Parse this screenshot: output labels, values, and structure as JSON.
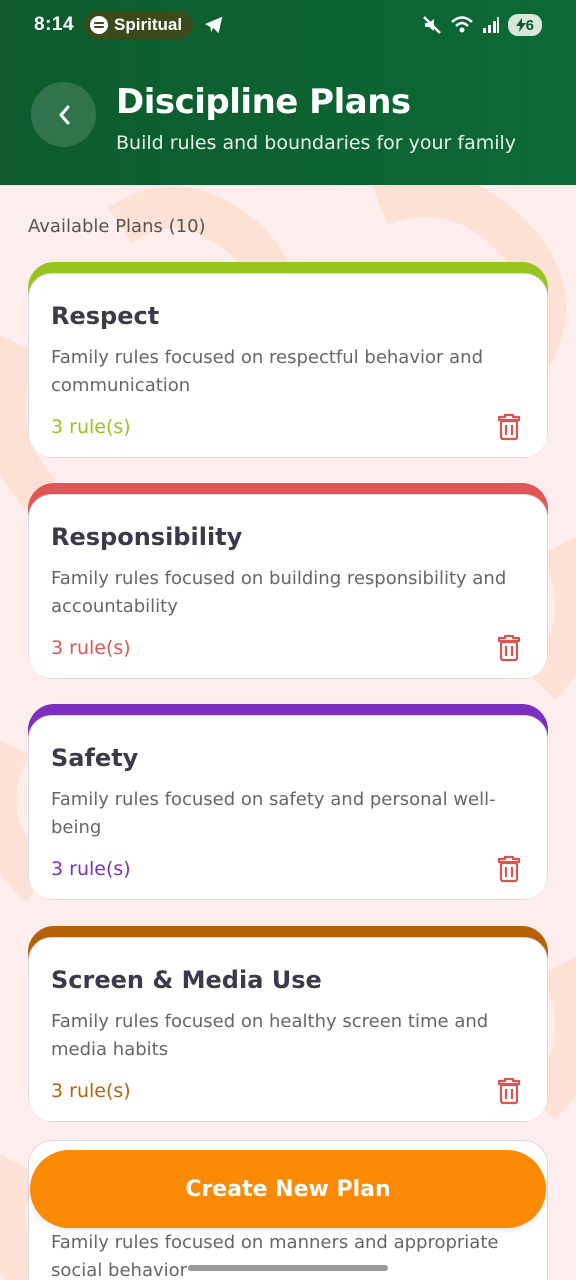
{
  "status_bar": {
    "time": "8:14",
    "spotify_label": "Spiritual",
    "battery": "6"
  },
  "header": {
    "title": "Discipline Plans",
    "subtitle": "Build rules and boundaries for your family"
  },
  "section": {
    "label": "Available Plans (10)"
  },
  "plans": [
    {
      "title": "Respect",
      "description": "Family rules focused on respectful behavior and communication",
      "rules": "3 rule(s)",
      "color": "#97c41d"
    },
    {
      "title": "Responsibility",
      "description": "Family rules focused on building responsibility and accountability",
      "rules": "3 rule(s)",
      "color": "#e05555"
    },
    {
      "title": "Safety",
      "description": "Family rules focused on safety and personal well-being",
      "rules": "3 rule(s)",
      "color": "#7a2fbe"
    },
    {
      "title": "Screen & Media Use",
      "description": "Family rules focused on healthy screen time and media habits",
      "rules": "3 rule(s)",
      "color": "#b5620a"
    }
  ],
  "partial_plan": {
    "description": "Family rules focused on manners and appropriate social behavior"
  },
  "actions": {
    "create_label": "Create New Plan"
  },
  "colors": {
    "header": "#0b6a36",
    "accent": "#fb8a06",
    "trash": "#d9534f",
    "background": "#fdeeed"
  }
}
